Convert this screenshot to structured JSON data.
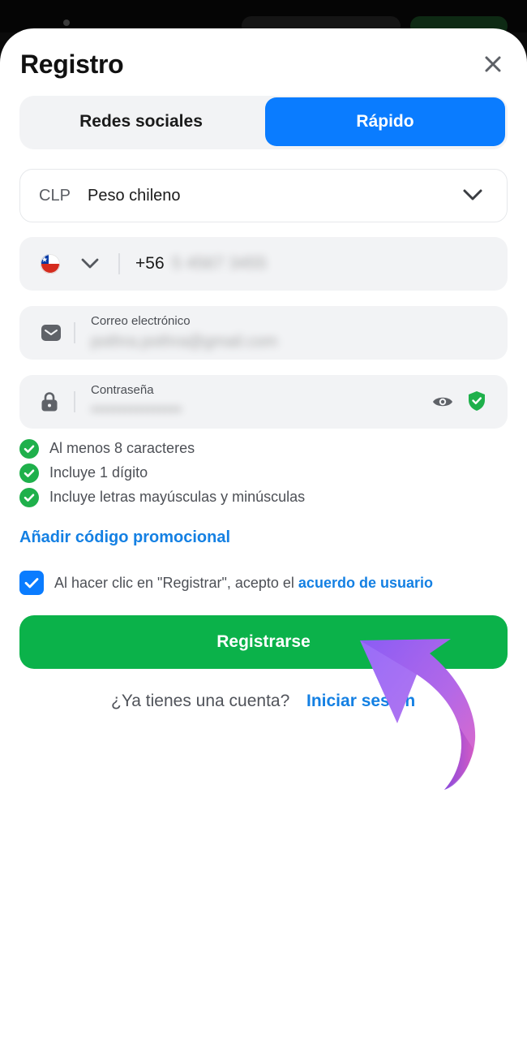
{
  "header": {
    "title": "Registro"
  },
  "tabs": [
    {
      "label": "Redes sociales",
      "active": false
    },
    {
      "label": "Rápido",
      "active": true
    }
  ],
  "currency": {
    "code": "CLP",
    "name": "Peso chileno"
  },
  "phone": {
    "country": "Chile",
    "prefix": "+56",
    "number_blurred": "5 4567 3455"
  },
  "email": {
    "label": "Correo electrónico",
    "value_blurred": "pothra.pothra@gmail.com"
  },
  "password": {
    "label": "Contraseña",
    "value_blurred": "••••••••••••••••"
  },
  "rules": [
    {
      "text": "Al menos 8 caracteres"
    },
    {
      "text": "Incluye 1 dígito"
    },
    {
      "text": "Incluye letras mayúsculas y minúsculas"
    }
  ],
  "promo": {
    "label": "Añadir código promocional"
  },
  "agreement": {
    "checked": true,
    "text": "Al hacer clic en \"Registrar\", acepto el ",
    "link": "acuerdo de usuario"
  },
  "register_button": {
    "label": "Registrarse"
  },
  "login": {
    "question": "¿Ya tienes una cuenta?",
    "link": "Iniciar sesión"
  },
  "colors": {
    "primary_blue": "#0a7cff",
    "link_blue": "#1480e3",
    "success_green": "#0bb24a",
    "field_bg": "#f2f3f5"
  },
  "icons": [
    "close-icon",
    "chevron-down-icon",
    "chile-flag-icon",
    "mail-icon",
    "lock-icon",
    "eye-icon",
    "shield-check-icon",
    "check-icon",
    "arrow-pointer"
  ]
}
